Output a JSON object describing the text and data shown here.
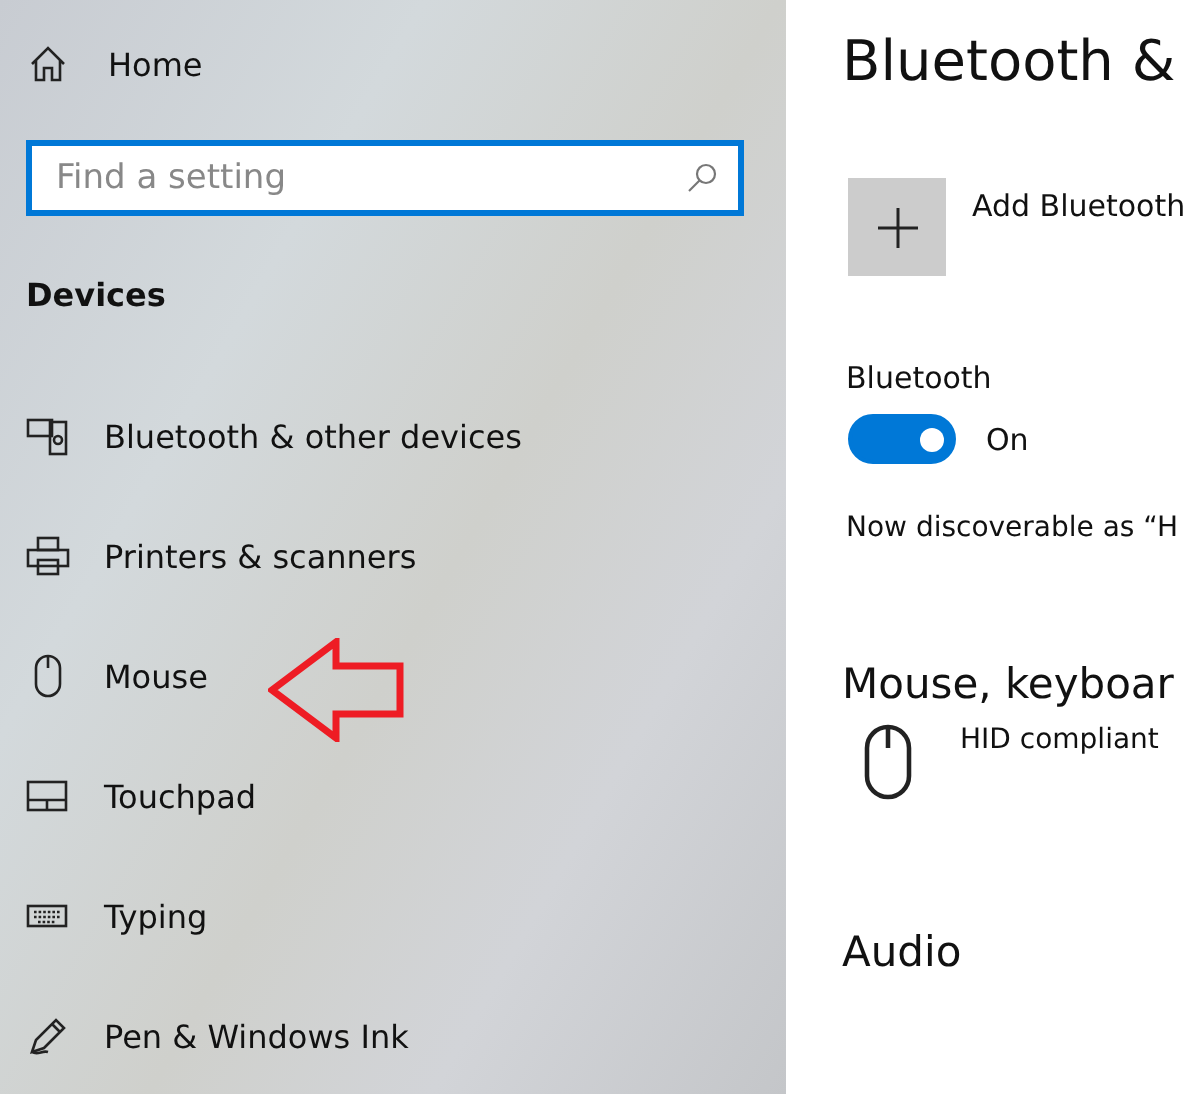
{
  "sidebar": {
    "home": {
      "label": "Home"
    },
    "search": {
      "placeholder": "Find a setting"
    },
    "section": "Devices",
    "items": [
      {
        "kind": "bluetooth",
        "label": "Bluetooth & other devices",
        "selected": false
      },
      {
        "kind": "printer",
        "label": "Printers & scanners",
        "selected": false
      },
      {
        "kind": "mouse",
        "label": "Mouse",
        "selected": false
      },
      {
        "kind": "touchpad",
        "label": "Touchpad",
        "selected": false
      },
      {
        "kind": "typing",
        "label": "Typing",
        "selected": false
      },
      {
        "kind": "pen",
        "label": "Pen & Windows Ink",
        "selected": false
      }
    ]
  },
  "main": {
    "title": "Bluetooth &",
    "add_button": {
      "label": "Add Bluetooth"
    },
    "bluetooth": {
      "label": "Bluetooth",
      "on": true,
      "state": "On"
    },
    "discoverable": "Now discoverable as “H",
    "sections": [
      {
        "title": "Mouse, keyboar",
        "devices": [
          {
            "kind": "mouse",
            "name": "HID compliant"
          }
        ]
      },
      {
        "title": "Audio"
      }
    ]
  }
}
